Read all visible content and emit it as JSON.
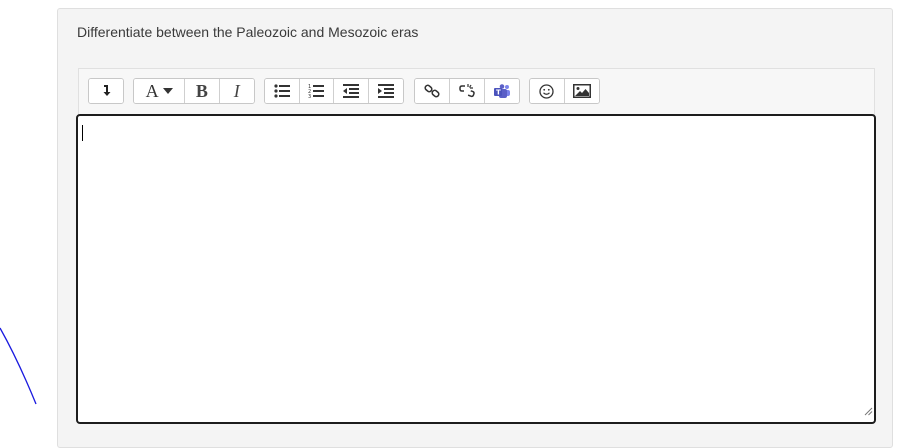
{
  "question": {
    "prompt": "Differentiate between the Paleozoic and Mesozoic eras"
  },
  "toolbar": {
    "groups": [
      {
        "name": "collapse",
        "buttons": [
          {
            "icon": "collapse-arrow-icon"
          }
        ]
      },
      {
        "name": "style",
        "buttons": [
          {
            "icon": "font-style-icon",
            "label": "A"
          },
          {
            "icon": "bold-icon",
            "label": "B"
          },
          {
            "icon": "italic-icon",
            "label": "I"
          }
        ]
      },
      {
        "name": "list",
        "buttons": [
          {
            "icon": "unordered-list-icon"
          },
          {
            "icon": "ordered-list-icon"
          },
          {
            "icon": "outdent-icon"
          },
          {
            "icon": "indent-icon"
          }
        ]
      },
      {
        "name": "links",
        "buttons": [
          {
            "icon": "link-icon"
          },
          {
            "icon": "unlink-icon"
          },
          {
            "icon": "teams-meeting-icon"
          }
        ]
      },
      {
        "name": "insert",
        "buttons": [
          {
            "icon": "emoji-icon"
          },
          {
            "icon": "image-icon"
          }
        ]
      }
    ]
  },
  "editor": {
    "value": ""
  },
  "colors": {
    "card_bg": "#f4f4f4",
    "teams_icon": "#5b5fc7",
    "editor_border": "#1d1d1d",
    "pen_stroke": "#1a1adf"
  }
}
